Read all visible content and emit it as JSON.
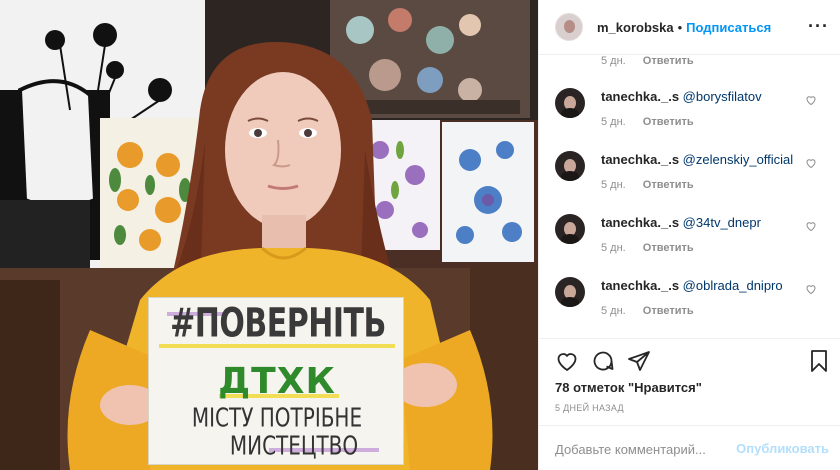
{
  "header": {
    "username": "m_korobska",
    "separator": "•",
    "follow_label": "Подписаться",
    "more_icon": "more-options-icon"
  },
  "photo": {
    "sign_line1": "#ПОВЕРНІТЬ",
    "sign_line2": "ДТХК",
    "sign_line3": "МІСТУ ПОТРІБНЕ",
    "sign_line4": "МИСТЕЦТВО"
  },
  "comments": {
    "top_meta": {
      "time": "5 дн.",
      "reply": "Ответить"
    },
    "items": [
      {
        "user": "tanechka._.s",
        "mention": "@borysfilatov",
        "time": "5 дн.",
        "reply": "Ответить"
      },
      {
        "user": "tanechka._.s",
        "mention": "@zelenskiy_official",
        "time": "5 дн.",
        "reply": "Ответить"
      },
      {
        "user": "tanechka._.s",
        "mention": "@34tv_dnepr",
        "time": "5 дн.",
        "reply": "Ответить"
      },
      {
        "user": "tanechka._.s",
        "mention": "@oblrada_dnipro",
        "time": "5 дн.",
        "reply": "Ответить"
      }
    ]
  },
  "actions": {
    "likes_text": "78 отметок \"Нравится\"",
    "posted_ago": "5 ДНЕЙ НАЗАД"
  },
  "add_comment": {
    "placeholder": "Добавьте комментарий...",
    "post_label": "Опубликовать"
  },
  "colors": {
    "link_blue": "#0095f6",
    "mention_blue": "#00376b",
    "muted": "#8e8e8e",
    "post_disabled": "#b2dffc"
  }
}
